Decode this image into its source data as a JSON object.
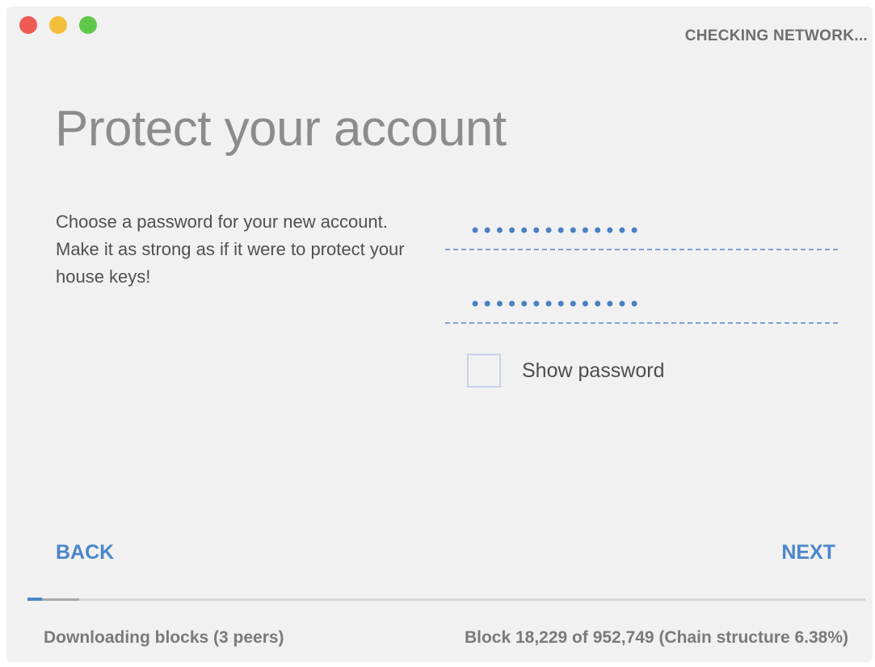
{
  "window": {
    "status": "CHECKING NETWORK..."
  },
  "colors": {
    "accent": "#4a86cc",
    "traffic_close": "#ee5a54",
    "traffic_minimize": "#f5bd3c",
    "traffic_zoom": "#5fc84b"
  },
  "page": {
    "title": "Protect your account",
    "description": "Choose a password for your new account. Make it as strong as if it were to protect your house keys!"
  },
  "form": {
    "password_value": "••••••••••••••",
    "repeat_password_value": "••••••••••••••",
    "show_password_label": "Show password",
    "show_password_checked": false
  },
  "navigation": {
    "back_label": "BACK",
    "next_label": "NEXT"
  },
  "footer": {
    "sync_status": "Downloading blocks (3 peers)",
    "block_progress": "Block 18,229 of 952,749 (Chain structure 6.38%)",
    "progress_percent": 6.38
  }
}
